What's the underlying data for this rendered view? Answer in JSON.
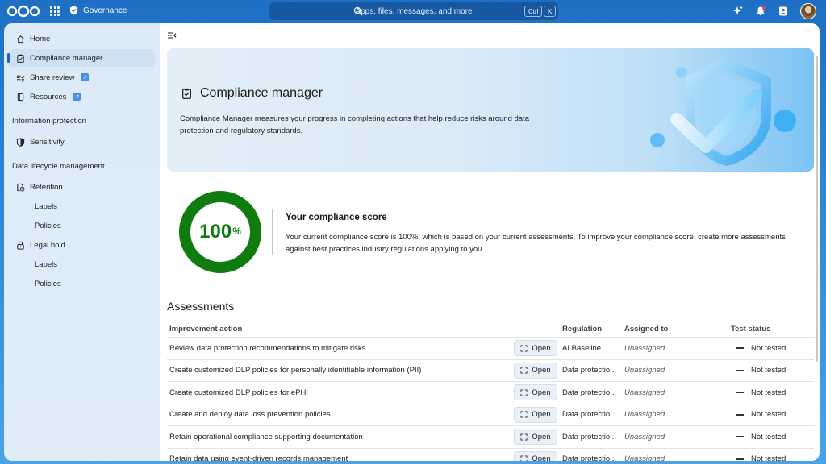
{
  "header": {
    "app_name": "Governance",
    "search_placeholder": "Apps, files, messages, and more",
    "kbd_ctrl": "Ctrl",
    "kbd_k": "K",
    "icons": [
      "nextcloud-logo",
      "apps-grid-icon",
      "shield-icon",
      "search-icon",
      "sparkle-icon",
      "bell-icon",
      "contacts-icon",
      "avatar"
    ]
  },
  "sidebar": {
    "items": [
      {
        "label": "Home",
        "icon": "home-icon"
      },
      {
        "label": "Compliance manager",
        "icon": "clipboard-check-icon",
        "active": true
      },
      {
        "label": "Share review",
        "icon": "share-review-icon",
        "external": true
      },
      {
        "label": "Resources",
        "icon": "book-icon",
        "external": true
      }
    ],
    "section_info": "Information protection",
    "sensitivity": "Sensitivity",
    "section_lifecycle": "Data lifecycle management",
    "retention": "Retention",
    "retention_labels": "Labels",
    "retention_policies": "Policies",
    "legal_hold": "Legal hold",
    "legal_labels": "Labels",
    "legal_policies": "Policies"
  },
  "banner": {
    "title": "Compliance manager",
    "description": "Compliance Manager measures your progress in completing actions that help reduce risks around data protection and regulatory standards."
  },
  "score": {
    "value": "100",
    "unit": "%",
    "fraction": 1.0,
    "color": "#107c10",
    "title": "Your compliance score",
    "description": "Your current compliance score is 100%, which is based on your current assessments. To improve your compliance score, create more assessments against best practices industry regulations applying to you."
  },
  "assessments": {
    "title": "Assessments",
    "columns": {
      "action": "Improvement action",
      "regulation": "Regulation",
      "assigned": "Assigned to",
      "status": "Test status"
    },
    "open_label": "Open",
    "rows": [
      {
        "action": "Review data protection recommendations to mitigate risks",
        "regulation": "AI Baseline",
        "assigned": "Unassigned",
        "status": "Not tested"
      },
      {
        "action": "Create customized DLP policies for personally identifiable information (PII)",
        "regulation": "Data protectio...",
        "assigned": "Unassigned",
        "status": "Not tested"
      },
      {
        "action": "Create customized DLP policies for ePHI",
        "regulation": "Data protectio...",
        "assigned": "Unassigned",
        "status": "Not tested"
      },
      {
        "action": "Create and deploy data loss prevention policies",
        "regulation": "Data protectio...",
        "assigned": "Unassigned",
        "status": "Not tested"
      },
      {
        "action": "Retain operational compliance supporting documentation",
        "regulation": "Data protectio...",
        "assigned": "Unassigned",
        "status": "Not tested"
      },
      {
        "action": "Retain data using event-driven records management",
        "regulation": "Data protectio...",
        "assigned": "Unassigned",
        "status": "Not tested"
      }
    ]
  }
}
